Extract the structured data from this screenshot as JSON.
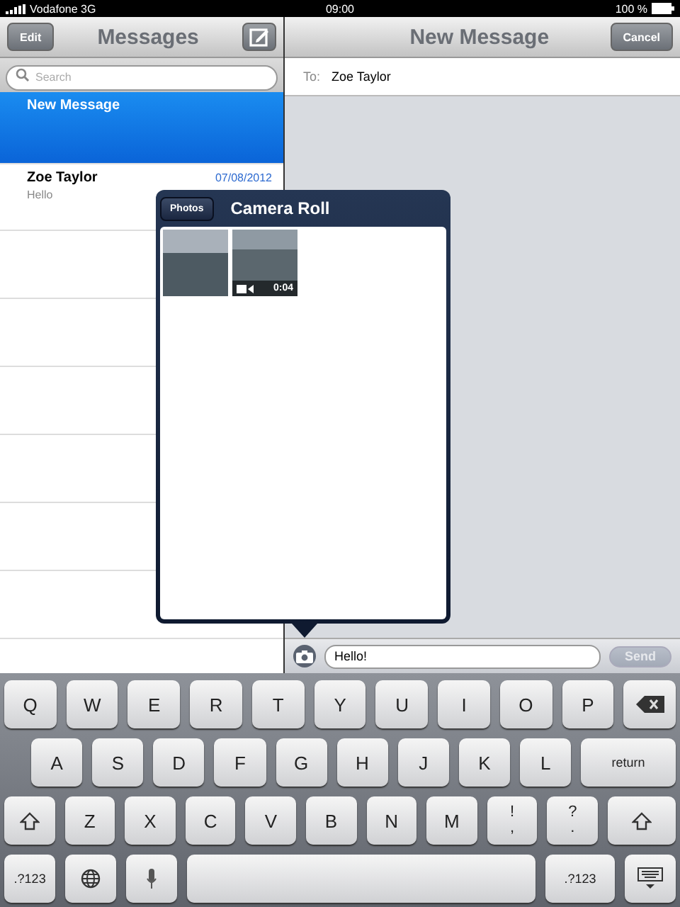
{
  "status_bar": {
    "carrier": "Vodafone 3G",
    "time": "09:00",
    "battery": "100 %"
  },
  "sidebar": {
    "edit_button": "Edit",
    "title": "Messages",
    "search": {
      "placeholder": "Search"
    },
    "conversations": [
      {
        "name": "New Message",
        "selected": true
      },
      {
        "name": "Zoe Taylor",
        "date": "07/08/2012",
        "preview": "Hello",
        "selected": false
      }
    ]
  },
  "compose": {
    "title": "New Message",
    "cancel_button": "Cancel",
    "to_label": "To:",
    "recipient": "Zoe Taylor",
    "message": "Hello!",
    "send_button": {
      "label": "Send",
      "disabled": true
    }
  },
  "popover": {
    "back_button": "Photos",
    "title": "Camera Roll",
    "items": [
      {
        "kind": "photo"
      },
      {
        "kind": "video",
        "duration": "0:04"
      }
    ]
  },
  "keyboard": {
    "rows": [
      {
        "keys": [
          {
            "kind": "char",
            "label": "Q"
          },
          {
            "kind": "char",
            "label": "W"
          },
          {
            "kind": "char",
            "label": "E"
          },
          {
            "kind": "char",
            "label": "R"
          },
          {
            "kind": "char",
            "label": "T"
          },
          {
            "kind": "char",
            "label": "Y"
          },
          {
            "kind": "char",
            "label": "U"
          },
          {
            "kind": "char",
            "label": "I"
          },
          {
            "kind": "char",
            "label": "O"
          },
          {
            "kind": "char",
            "label": "P"
          },
          {
            "kind": "backspace"
          }
        ]
      },
      {
        "keys": [
          {
            "kind": "char",
            "label": "A"
          },
          {
            "kind": "char",
            "label": "S"
          },
          {
            "kind": "char",
            "label": "D"
          },
          {
            "kind": "char",
            "label": "F"
          },
          {
            "kind": "char",
            "label": "G"
          },
          {
            "kind": "char",
            "label": "H"
          },
          {
            "kind": "char",
            "label": "J"
          },
          {
            "kind": "char",
            "label": "K"
          },
          {
            "kind": "char",
            "label": "L"
          },
          {
            "kind": "return",
            "label": "return"
          }
        ]
      },
      {
        "keys": [
          {
            "kind": "shift"
          },
          {
            "kind": "char",
            "label": "Z"
          },
          {
            "kind": "char",
            "label": "X"
          },
          {
            "kind": "char",
            "label": "C"
          },
          {
            "kind": "char",
            "label": "V"
          },
          {
            "kind": "char",
            "label": "B"
          },
          {
            "kind": "char",
            "label": "N"
          },
          {
            "kind": "char",
            "label": "M"
          },
          {
            "kind": "char",
            "label": "!",
            "sub": ","
          },
          {
            "kind": "char",
            "label": "?",
            "sub": "."
          },
          {
            "kind": "shift"
          }
        ]
      },
      {
        "keys": [
          {
            "kind": "mode",
            "label": ".?123"
          },
          {
            "kind": "globe"
          },
          {
            "kind": "mic"
          },
          {
            "kind": "space"
          },
          {
            "kind": "mode",
            "label": ".?123"
          },
          {
            "kind": "hide"
          }
        ]
      }
    ]
  }
}
